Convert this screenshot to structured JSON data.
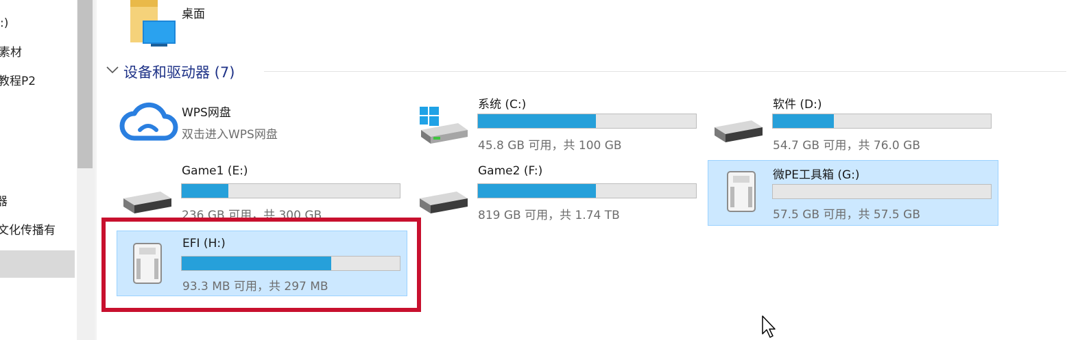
{
  "nav": {
    "items": [
      {
        "label": ":)"
      },
      {
        "label": "素材"
      },
      {
        "label": "教程P2"
      },
      {
        "label": "器"
      },
      {
        "label": "文化传播有"
      }
    ]
  },
  "quick_access": {
    "desktop_label": "桌面"
  },
  "devices_group": {
    "title": "设备和驱动器 (7)"
  },
  "drives": {
    "wps": {
      "name": "WPS网盘",
      "subtitle": "双击进入WPS网盘"
    },
    "c": {
      "name": "系统 (C:)",
      "usage": "45.8 GB 可用，共 100 GB",
      "used_fraction": 0.542
    },
    "d": {
      "name": "软件 (D:)",
      "usage": "54.7 GB 可用，共 76.0 GB",
      "used_fraction": 0.28
    },
    "e": {
      "name": "Game1 (E:)",
      "usage": "236 GB 可用，共 300 GB",
      "used_fraction": 0.213
    },
    "f": {
      "name": "Game2 (F:)",
      "usage": "819 GB 可用，共 1.74 TB",
      "used_fraction": 0.54
    },
    "g": {
      "name": "微PE工具箱 (G:)",
      "usage": "57.5 GB 可用，共 57.5 GB",
      "used_fraction": 0.0
    },
    "h": {
      "name": "EFI (H:)",
      "usage": "93.3 MB 可用，共 297 MB",
      "used_fraction": 0.686
    }
  },
  "colors": {
    "bar_fill": "#26a0da",
    "selection": "#cce8ff",
    "highlight": "#c8102e",
    "group_title": "#1e3287"
  }
}
